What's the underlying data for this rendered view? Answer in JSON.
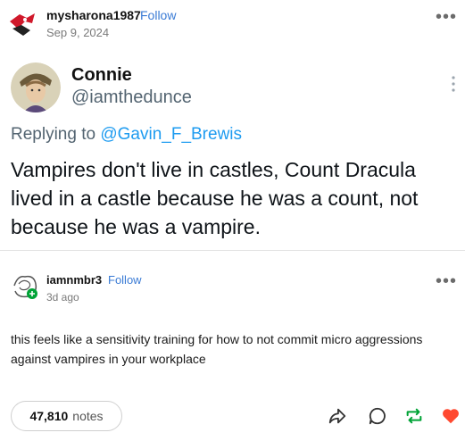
{
  "post": {
    "author": "mysharona1987",
    "follow_label": "Follow",
    "date": "Sep 9, 2024"
  },
  "tweet": {
    "name": "Connie",
    "handle": "@iamthedunce",
    "replying_prefix": "Replying to ",
    "replying_handle": "@Gavin_F_Brewis",
    "text": "Vampires don't live in castles, Count Dracula lived in a castle because he was a count, not because he was a vampire."
  },
  "reply": {
    "author": "iamnmbr3",
    "follow_label": "Follow",
    "age": "3d ago",
    "text": "this feels like a sensitivity training for how to not commit micro aggressions against vampires in your workplace"
  },
  "footer": {
    "notes_count": "47,810",
    "notes_label": "notes"
  },
  "icons": {
    "share": "share-icon",
    "reply": "reply-icon",
    "reblog": "reblog-icon",
    "like": "heart-icon"
  },
  "colors": {
    "follow": "#3a7bd5",
    "mention": "#1d9bf0",
    "reblog": "#00a336",
    "like": "#ff4930"
  }
}
